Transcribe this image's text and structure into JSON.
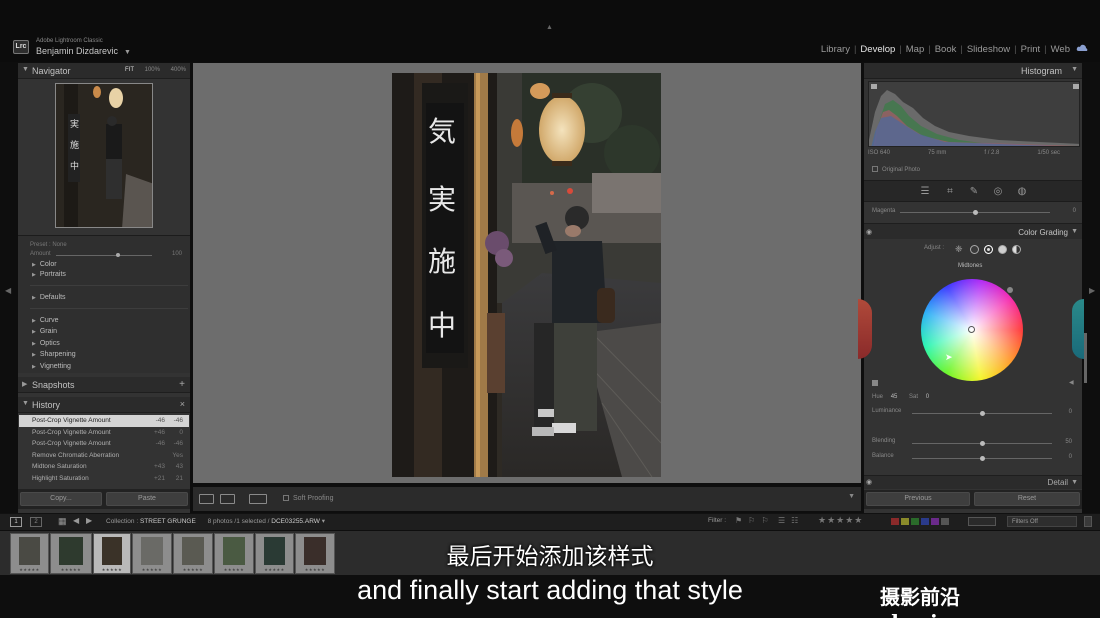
{
  "app": {
    "logo_text": "Lrc",
    "name": "Adobe Lightroom Classic",
    "user": "Benjamin Dizdarevic"
  },
  "modules": [
    "Library",
    "Develop",
    "Map",
    "Book",
    "Slideshow",
    "Print",
    "Web"
  ],
  "active_module": "Develop",
  "left_panel": {
    "navigator": {
      "title": "Navigator",
      "zoom_options": [
        "FIT",
        "100%",
        "400%"
      ],
      "active_zoom": "FIT"
    },
    "preset_amount": {
      "label": "Preset : None",
      "amount_label": "Amount",
      "amount_value": "100"
    },
    "preset_groups": [
      {
        "label": "Color"
      },
      {
        "label": "Portraits"
      },
      {
        "label": "Defaults"
      },
      {
        "label": "Curve"
      },
      {
        "label": "Grain"
      },
      {
        "label": "Optics"
      },
      {
        "label": "Sharpening"
      },
      {
        "label": "Vignetting"
      }
    ],
    "snapshots": {
      "title": "Snapshots",
      "action": "+"
    },
    "history": {
      "title": "History",
      "action": "×",
      "items": [
        {
          "label": "Post-Crop Vignette Amount",
          "v1": "-46",
          "v2": "-46",
          "selected": true
        },
        {
          "label": "Post-Crop Vignette Amount",
          "v1": "+46",
          "v2": "0",
          "selected": false
        },
        {
          "label": "Post-Crop Vignette Amount",
          "v1": "-46",
          "v2": "-46",
          "selected": false
        },
        {
          "label": "Remove Chromatic Aberration",
          "v1": "",
          "v2": "Yes",
          "selected": false
        },
        {
          "label": "Midtone Saturation",
          "v1": "+43",
          "v2": "43",
          "selected": false
        },
        {
          "label": "Highlight Saturation",
          "v1": "+21",
          "v2": "21",
          "selected": false
        }
      ]
    },
    "copy_label": "Copy...",
    "paste_label": "Paste"
  },
  "toolbar": {
    "soft_proofing_label": "Soft Proofing"
  },
  "photo": {
    "sign_chars": [
      "気",
      "実",
      "施",
      "中"
    ]
  },
  "right_panel": {
    "histogram_title": "Histogram",
    "histogram_info": [
      "ISO 640",
      "75 mm",
      "f / 2.8",
      "1/50 sec"
    ],
    "original_photo_label": "Original Photo",
    "magenta": {
      "label": "Magenta",
      "value": "0",
      "fraction": 0.5
    },
    "color_grading": {
      "title": "Color Grading",
      "adjust_label": "Adjust :",
      "mode_label": "Midtones",
      "hue_label": "Hue",
      "hue_value": "45",
      "sat_label": "Sat",
      "sat_value": "0",
      "luminance": {
        "label": "Luminance",
        "value": "0",
        "fraction": 0.5
      },
      "blending": {
        "label": "Blending",
        "value": "50",
        "fraction": 0.5
      },
      "balance": {
        "label": "Balance",
        "value": "0",
        "fraction": 0.5
      }
    },
    "detail_title": "Detail",
    "previous_label": "Previous",
    "reset_label": "Reset"
  },
  "filmstrip": {
    "collection_label": "Collection :",
    "collection_name": "STREET GRUNGE",
    "photo_count": "8 photos /1 selected /",
    "filename": "DCE03255.ARW",
    "filter_label": "Filter :",
    "filters_off": "Filters Off",
    "rating_stars": "★★★★★",
    "color_labels": [
      "#8a2a2a",
      "#8a8a2a",
      "#2a6a2a",
      "#2a3a8a",
      "#6a2a8a",
      "#555555"
    ],
    "selected_index": 2
  },
  "subtitles": {
    "cn": "最后开始添加该样式",
    "en": "and finally start adding that style"
  },
  "watermark": "摄影前沿sheyingzyz.com"
}
